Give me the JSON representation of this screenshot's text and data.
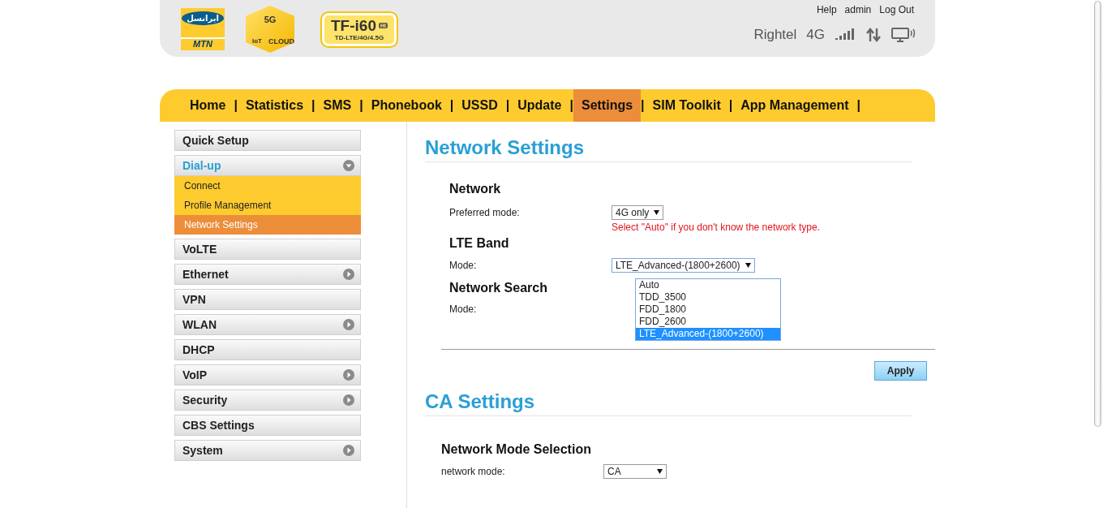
{
  "header": {
    "logos": {
      "operator_persian": "ایرانسل",
      "operator_latin": "MTN",
      "cube_top": "5G",
      "cube_left": "IoT",
      "cube_right": "CLOUD",
      "model": "TF-i60",
      "model_tag": "Hi",
      "model_sub": "TD-LTE/4G/4.5G"
    },
    "links": [
      "Help",
      "admin",
      "Log Out"
    ],
    "status": {
      "operator": "Rightel",
      "network_type": "4G"
    }
  },
  "nav": {
    "separator": "|",
    "items": [
      {
        "label": "Home",
        "selected": false
      },
      {
        "label": "Statistics",
        "selected": false
      },
      {
        "label": "SMS",
        "selected": false
      },
      {
        "label": "Phonebook",
        "selected": false
      },
      {
        "label": "USSD",
        "selected": false
      },
      {
        "label": "Update",
        "selected": false
      },
      {
        "label": "Settings",
        "selected": true
      },
      {
        "label": "SIM Toolkit",
        "selected": false
      },
      {
        "label": "App Management",
        "selected": false
      }
    ]
  },
  "sidebar": {
    "items": [
      {
        "label": "Quick Setup",
        "kind": "plain"
      },
      {
        "label": "Dial-up",
        "kind": "group",
        "expanded": true,
        "children": [
          {
            "label": "Connect",
            "selected": false
          },
          {
            "label": "Profile Management",
            "selected": false
          },
          {
            "label": "Network Settings",
            "selected": true
          }
        ]
      },
      {
        "label": "VoLTE",
        "kind": "plain"
      },
      {
        "label": "Ethernet",
        "kind": "group",
        "expanded": false
      },
      {
        "label": "VPN",
        "kind": "plain"
      },
      {
        "label": "WLAN",
        "kind": "group",
        "expanded": false
      },
      {
        "label": "DHCP",
        "kind": "plain"
      },
      {
        "label": "VoIP",
        "kind": "group",
        "expanded": false
      },
      {
        "label": "Security",
        "kind": "group",
        "expanded": false
      },
      {
        "label": "CBS Settings",
        "kind": "plain"
      },
      {
        "label": "System",
        "kind": "group",
        "expanded": false
      }
    ]
  },
  "network_settings": {
    "title": "Network Settings",
    "network": {
      "heading": "Network",
      "preferred_mode_label": "Preferred mode:",
      "preferred_mode_value": "4G only",
      "hint": "Select \"Auto\" if you don't know the network type."
    },
    "lte_band": {
      "heading": "LTE Band",
      "mode_label": "Mode:",
      "mode_value": "LTE_Advanced-(1800+2600)",
      "options": [
        {
          "label": "Auto",
          "selected": false
        },
        {
          "label": "TDD_3500",
          "selected": false
        },
        {
          "label": "FDD_1800",
          "selected": false
        },
        {
          "label": "FDD_2600",
          "selected": false
        },
        {
          "label": "LTE_Advanced-(1800+2600)",
          "selected": true
        }
      ]
    },
    "network_search": {
      "heading": "Network Search",
      "mode_label": "Mode:"
    },
    "apply_button": "Apply"
  },
  "ca_settings": {
    "title": "CA Settings",
    "heading": "Network Mode Selection",
    "network_mode_label": "network mode:",
    "network_mode_value": "CA"
  }
}
